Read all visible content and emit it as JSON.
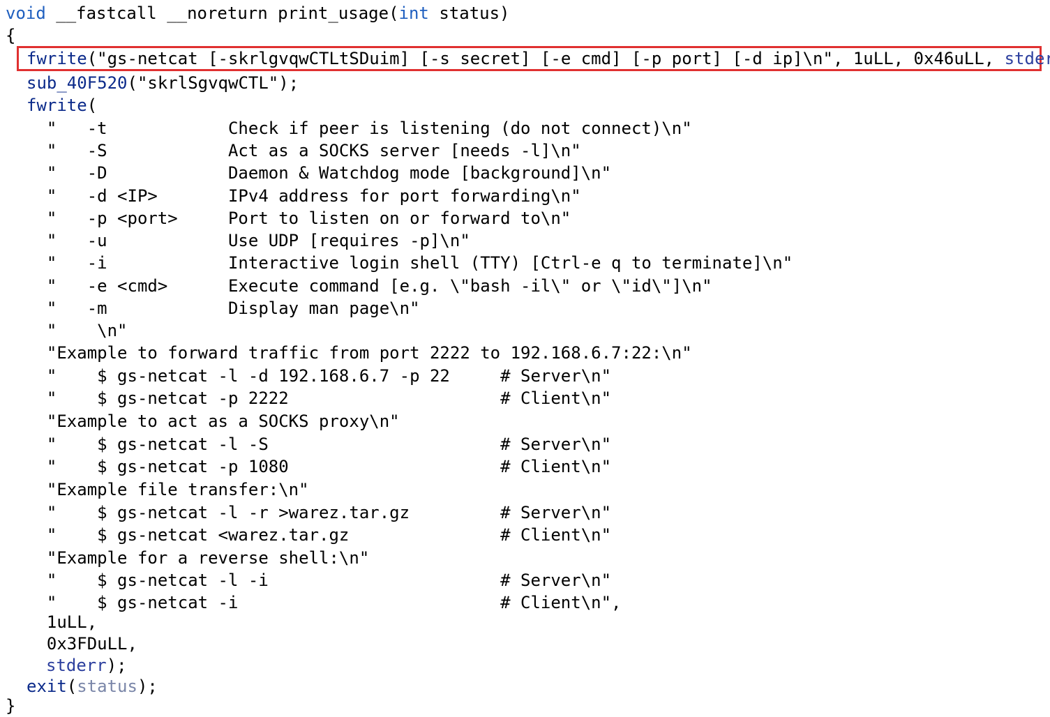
{
  "code": {
    "signature": {
      "kw_void": "void",
      "rest_before_int": " __fastcall __noreturn print_usage(",
      "kw_int": "int",
      "rest_after_int": " status)"
    },
    "open_brace": "{",
    "fwrite1": {
      "fn": "fwrite",
      "str": "(\"gs-netcat [-skrlgvqwCTLtSDuim] [-s secret] [-e cmd] [-p port] [-d ip]\\n\", 1uLL, 0x46uLL, ",
      "stderr": "stderr",
      "end": ");"
    },
    "sub": {
      "fn": "sub_40F520",
      "str": "(\"skrlSgvqwCTL\");"
    },
    "fwrite2": {
      "fn": "fwrite",
      "open": "("
    },
    "string_lines": [
      "  \"   -t            Check if peer is listening (do not connect)\\n\"",
      "  \"   -S            Act as a SOCKS server [needs -l]\\n\"",
      "  \"   -D            Daemon & Watchdog mode [background]\\n\"",
      "  \"   -d <IP>       IPv4 address for port forwarding\\n\"",
      "  \"   -p <port>     Port to listen on or forward to\\n\"",
      "  \"   -u            Use UDP [requires -p]\\n\"",
      "  \"   -i            Interactive login shell (TTY) [Ctrl-e q to terminate]\\n\"",
      "  \"   -e <cmd>      Execute command [e.g. \\\"bash -il\\\" or \\\"id\\\"]\\n\"",
      "  \"   -m            Display man page\\n\"",
      "  \"    \\n\"",
      "  \"Example to forward traffic from port 2222 to 192.168.6.7:22:\\n\"",
      "  \"    $ gs-netcat -l -d 192.168.6.7 -p 22     # Server\\n\"",
      "  \"    $ gs-netcat -p 2222                     # Client\\n\"",
      "  \"Example to act as a SOCKS proxy\\n\"",
      "  \"    $ gs-netcat -l -S                       # Server\\n\"",
      "  \"    $ gs-netcat -p 1080                     # Client\\n\"",
      "  \"Example file transfer:\\n\"",
      "  \"    $ gs-netcat -l -r >warez.tar.gz         # Server\\n\"",
      "  \"    $ gs-netcat <warez.tar.gz               # Client\\n\"",
      "  \"Example for a reverse shell:\\n\"",
      "  \"    $ gs-netcat -l -i                       # Server\\n\"",
      "  \"    $ gs-netcat -i                          # Client\\n\","
    ],
    "arg_size": "  1uLL,",
    "arg_count": "  0x3FDuLL,",
    "arg_stream": "stderr",
    "arg_stream_end": ");",
    "exit": {
      "fn": "exit",
      "open": "(",
      "arg": "status",
      "close": ");"
    },
    "close_brace": "}"
  },
  "colors": {
    "keyword": "#1f5fbf",
    "function": "#0b2a8a",
    "highlight_border": "#e03030"
  }
}
